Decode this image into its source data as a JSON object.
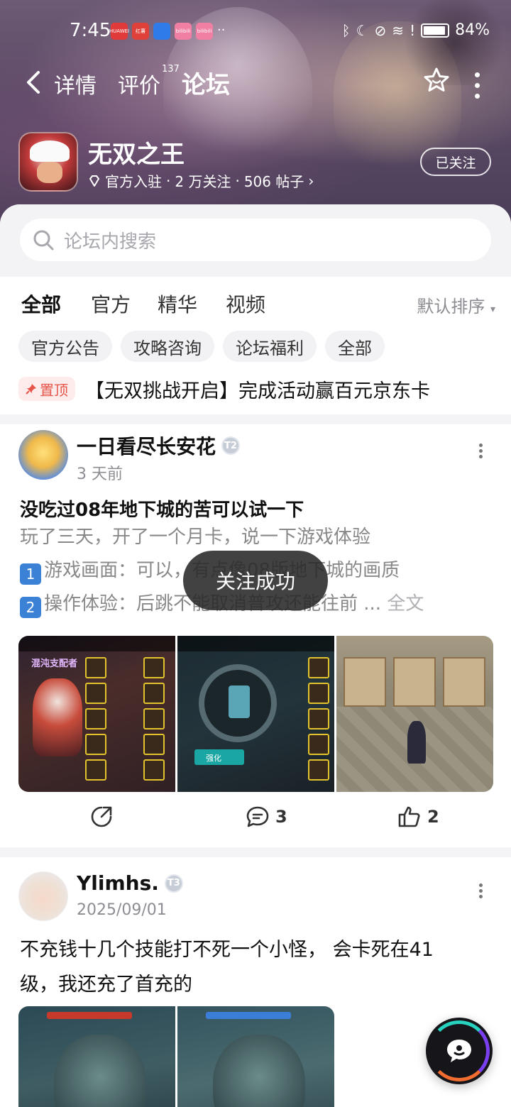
{
  "status_bar": {
    "time": "7:45",
    "battery": "84%",
    "apps": [
      {
        "name": "HUAWEI",
        "color": "#e03a3a"
      },
      {
        "name": "红薯",
        "color": "#e0403a"
      },
      {
        "name": "",
        "color": "#2f7be8"
      },
      {
        "name": "bilibili",
        "color": "#f17fa3"
      },
      {
        "name": "bilibili",
        "color": "#f17fa3"
      }
    ]
  },
  "nav": {
    "tabs": [
      {
        "label": "详情"
      },
      {
        "label": "评价"
      },
      {
        "label": "论坛"
      }
    ],
    "review_count": "137"
  },
  "game": {
    "name": "无双之王",
    "meta_official": "官方入驻",
    "meta_followers": "2 万关注",
    "meta_posts": "506 帖子",
    "follow_label": "已关注"
  },
  "search": {
    "placeholder": "论坛内搜索"
  },
  "filter_tabs": [
    {
      "label": "全部"
    },
    {
      "label": "官方"
    },
    {
      "label": "精华"
    },
    {
      "label": "视频"
    }
  ],
  "sort_label": "默认排序",
  "chips": [
    {
      "label": "官方公告"
    },
    {
      "label": "攻略咨询"
    },
    {
      "label": "论坛福利"
    },
    {
      "label": "全部"
    }
  ],
  "pinned": {
    "badge": "置顶",
    "title": "【无双挑战开启】完成活动赢百元京东卡"
  },
  "posts": [
    {
      "author": "一日看尽长安花",
      "level": "T2",
      "time": "3 天前",
      "title": "没吃过08年地下城的苦可以试一下",
      "body_line1": "玩了三天，开了一个月卡，说一下游戏体验",
      "body_line2_num": "1",
      "body_line2": "游戏画面：可以，有点像08版地下城的画质",
      "body_line3_num": "2",
      "body_line3": "操作体验：后跳不能取消普攻还能往前 ...",
      "fulltext_label": "全文",
      "images": [
        {
          "caption": "混沌支配者"
        },
        {
          "caption": "强化"
        },
        {
          "caption": ""
        }
      ],
      "comments": "3",
      "likes": "2"
    },
    {
      "author": "Ylimhs.",
      "level": "T3",
      "time": "2025/09/01",
      "text_line1": "不充钱十几个技能打不死一个小怪， 会卡死在41",
      "text_line2": "级，我还充了首充的"
    }
  ],
  "toast": "关注成功",
  "colors": {
    "accent": "#22c5b5",
    "pin": "#e8534a"
  }
}
